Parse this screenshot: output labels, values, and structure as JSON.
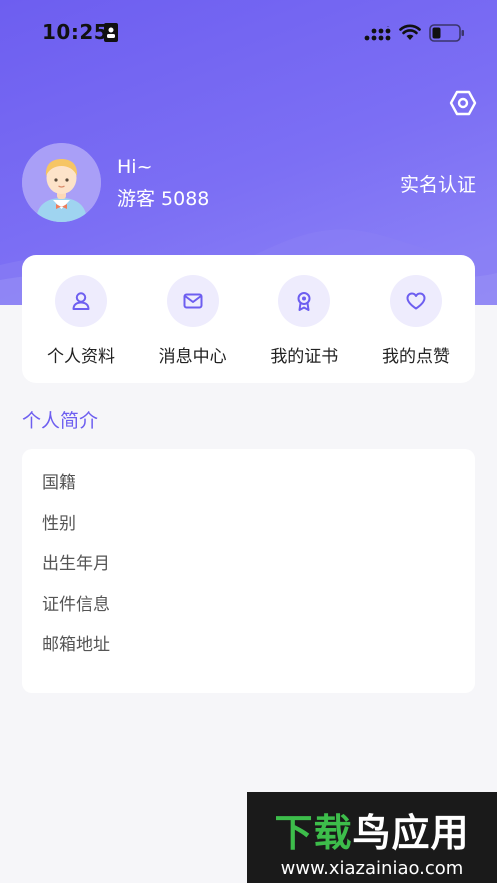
{
  "status_bar": {
    "time": "10:25"
  },
  "profile": {
    "greeting": "Hi~",
    "username": "游客 5088",
    "verify_label": "实名认证"
  },
  "quick_actions": [
    {
      "label": "个人资料",
      "icon": "user-icon"
    },
    {
      "label": "消息中心",
      "icon": "mail-icon"
    },
    {
      "label": "我的证书",
      "icon": "badge-icon"
    },
    {
      "label": "我的点赞",
      "icon": "heart-icon"
    }
  ],
  "intro": {
    "title": "个人简介",
    "fields": [
      "国籍",
      "性别",
      "出生年月",
      "证件信息",
      "邮箱地址"
    ]
  },
  "watermark": {
    "logo_part1": "下载",
    "logo_part2": "鸟应用",
    "url": "www.xiazainiao.com"
  },
  "colors": {
    "accent": "#6d5ef0",
    "icon_bg": "#eeecfd",
    "page_bg": "#f6f6f9"
  }
}
